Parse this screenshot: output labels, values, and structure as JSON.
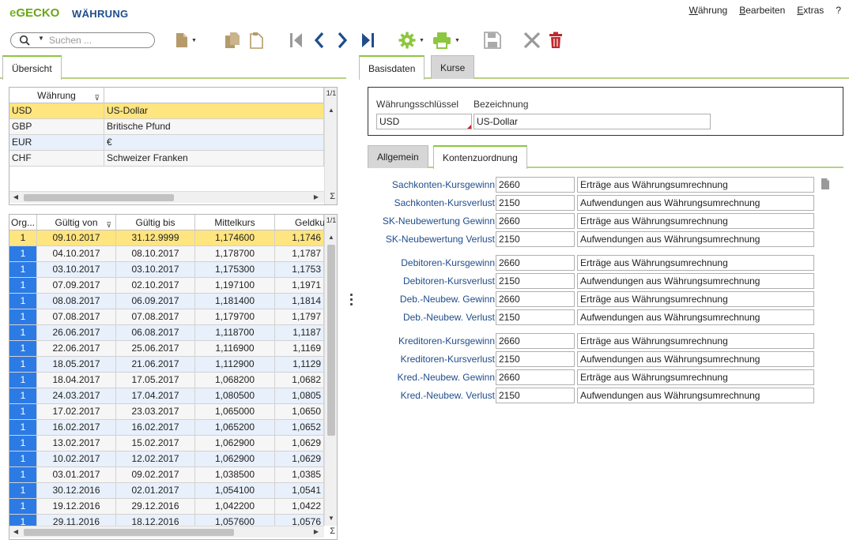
{
  "app": {
    "logo_e": "e",
    "logo_rest": "GECKO",
    "title": "WÄHRUNG"
  },
  "menu": [
    {
      "first": "W",
      "rest": "ährung"
    },
    {
      "first": "B",
      "rest": "earbeiten"
    },
    {
      "first": "E",
      "rest": "xtras"
    },
    {
      "first": "?",
      "rest": ""
    }
  ],
  "search": {
    "placeholder": "Suchen ..."
  },
  "left_tab": "Übersicht",
  "currency_grid": {
    "headers": [
      "Währung",
      ""
    ],
    "page": "1/1",
    "rows": [
      [
        "USD",
        "US-Dollar"
      ],
      [
        "GBP",
        "Britische Pfund"
      ],
      [
        "EUR",
        "€"
      ],
      [
        "CHF",
        "Schweizer Franken"
      ]
    ],
    "sigma": "Σ"
  },
  "rate_grid": {
    "headers": [
      "Org...",
      "Gültig von",
      "Gültig bis",
      "Mittelkurs",
      "Geldkurs"
    ],
    "page": "1/1",
    "rows": [
      [
        "1",
        "09.10.2017",
        "31.12.9999",
        "1,174600",
        "1,1746"
      ],
      [
        "1",
        "04.10.2017",
        "08.10.2017",
        "1,178700",
        "1,1787"
      ],
      [
        "1",
        "03.10.2017",
        "03.10.2017",
        "1,175300",
        "1,1753"
      ],
      [
        "1",
        "07.09.2017",
        "02.10.2017",
        "1,197100",
        "1,1971"
      ],
      [
        "1",
        "08.08.2017",
        "06.09.2017",
        "1,181400",
        "1,1814"
      ],
      [
        "1",
        "07.08.2017",
        "07.08.2017",
        "1,179700",
        "1,1797"
      ],
      [
        "1",
        "26.06.2017",
        "06.08.2017",
        "1,118700",
        "1,1187"
      ],
      [
        "1",
        "22.06.2017",
        "25.06.2017",
        "1,116900",
        "1,1169"
      ],
      [
        "1",
        "18.05.2017",
        "21.06.2017",
        "1,112900",
        "1,1129"
      ],
      [
        "1",
        "18.04.2017",
        "17.05.2017",
        "1,068200",
        "1,0682"
      ],
      [
        "1",
        "24.03.2017",
        "17.04.2017",
        "1,080500",
        "1,0805"
      ],
      [
        "1",
        "17.02.2017",
        "23.03.2017",
        "1,065000",
        "1,0650"
      ],
      [
        "1",
        "16.02.2017",
        "16.02.2017",
        "1,065200",
        "1,0652"
      ],
      [
        "1",
        "13.02.2017",
        "15.02.2017",
        "1,062900",
        "1,0629"
      ],
      [
        "1",
        "10.02.2017",
        "12.02.2017",
        "1,062900",
        "1,0629"
      ],
      [
        "1",
        "03.01.2017",
        "09.02.2017",
        "1,038500",
        "1,0385"
      ],
      [
        "1",
        "30.12.2016",
        "02.01.2017",
        "1,054100",
        "1,0541"
      ],
      [
        "1",
        "19.12.2016",
        "29.12.2016",
        "1,042200",
        "1,0422"
      ],
      [
        "1",
        "29.11.2016",
        "18.12.2016",
        "1,057600",
        "1,0576"
      ]
    ],
    "sigma": "Σ"
  },
  "right_tabs": [
    "Basisdaten",
    "Kurse"
  ],
  "key_section": {
    "key_label": "Währungsschlüssel",
    "name_label": "Bezeichnung",
    "key_value": "USD",
    "name_value": "US-Dollar"
  },
  "sub_tabs": [
    "Allgemein",
    "Kontenzuordnung"
  ],
  "accounts": [
    {
      "label": "Sachkonten-Kursgewinn",
      "account": "2660",
      "text": "Erträge aus Währungsumrechnung"
    },
    {
      "label": "Sachkonten-Kursverlust",
      "account": "2150",
      "text": "Aufwendungen aus Währungsumrechnung"
    },
    {
      "label": "SK-Neubewertung Gewinn",
      "account": "2660",
      "text": "Erträge aus Währungsumrechnung"
    },
    {
      "label": "SK-Neubewertung Verlust",
      "account": "2150",
      "text": "Aufwendungen aus Währungsumrechnung"
    },
    {
      "label": "Debitoren-Kursgewinn",
      "account": "2660",
      "text": "Erträge aus Währungsumrechnung"
    },
    {
      "label": "Debitoren-Kursverlust",
      "account": "2150",
      "text": "Aufwendungen aus Währungsumrechnung"
    },
    {
      "label": "Deb.-Neubew. Gewinn",
      "account": "2660",
      "text": "Erträge aus Währungsumrechnung"
    },
    {
      "label": "Deb.-Neubew. Verlust",
      "account": "2150",
      "text": "Aufwendungen aus Währungsumrechnung"
    },
    {
      "label": "Kreditoren-Kursgewinn",
      "account": "2660",
      "text": "Erträge aus Währungsumrechnung"
    },
    {
      "label": "Kreditoren-Kursverlust",
      "account": "2150",
      "text": "Aufwendungen aus Währungsumrechnung"
    },
    {
      "label": "Kred.-Neubew. Gewinn",
      "account": "2660",
      "text": "Erträge aus Währungsumrechnung"
    },
    {
      "label": "Kred.-Neubew. Verlust",
      "account": "2150",
      "text": "Aufwendungen aus Währungsumrechnung"
    }
  ],
  "colors": {
    "brand_green": "#7ab51d",
    "title_blue": "#1f4d8c",
    "selection_yellow": "#ffe57f",
    "org_blue": "#2c7be5",
    "delete_red": "#c0282d"
  }
}
